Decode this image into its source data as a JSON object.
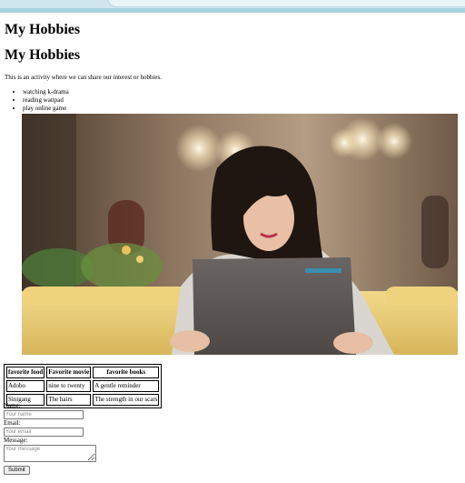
{
  "page": {
    "heading_1": "My Hobbies",
    "heading_2": "My Hobbies",
    "description": "This is an activity where we can share our interest or hobbies."
  },
  "hobbies": [
    "watching k-drama",
    "reading wattpad",
    "play online game"
  ],
  "table": {
    "headers": [
      "favorite food",
      "Favorite movie",
      "favorite books"
    ],
    "rows": [
      [
        "Adobo",
        "nine to twenty",
        "A gentle reminder"
      ],
      [
        "Sinigang",
        "The hairs",
        "The strength in our scars"
      ]
    ]
  },
  "form": {
    "name_label": "Name:",
    "name_placeholder": "Your name",
    "email_label": "Email:",
    "email_placeholder": "Your email",
    "message_label": "Message:",
    "message_placeholder": "Your message",
    "submit_label": "Submit"
  }
}
